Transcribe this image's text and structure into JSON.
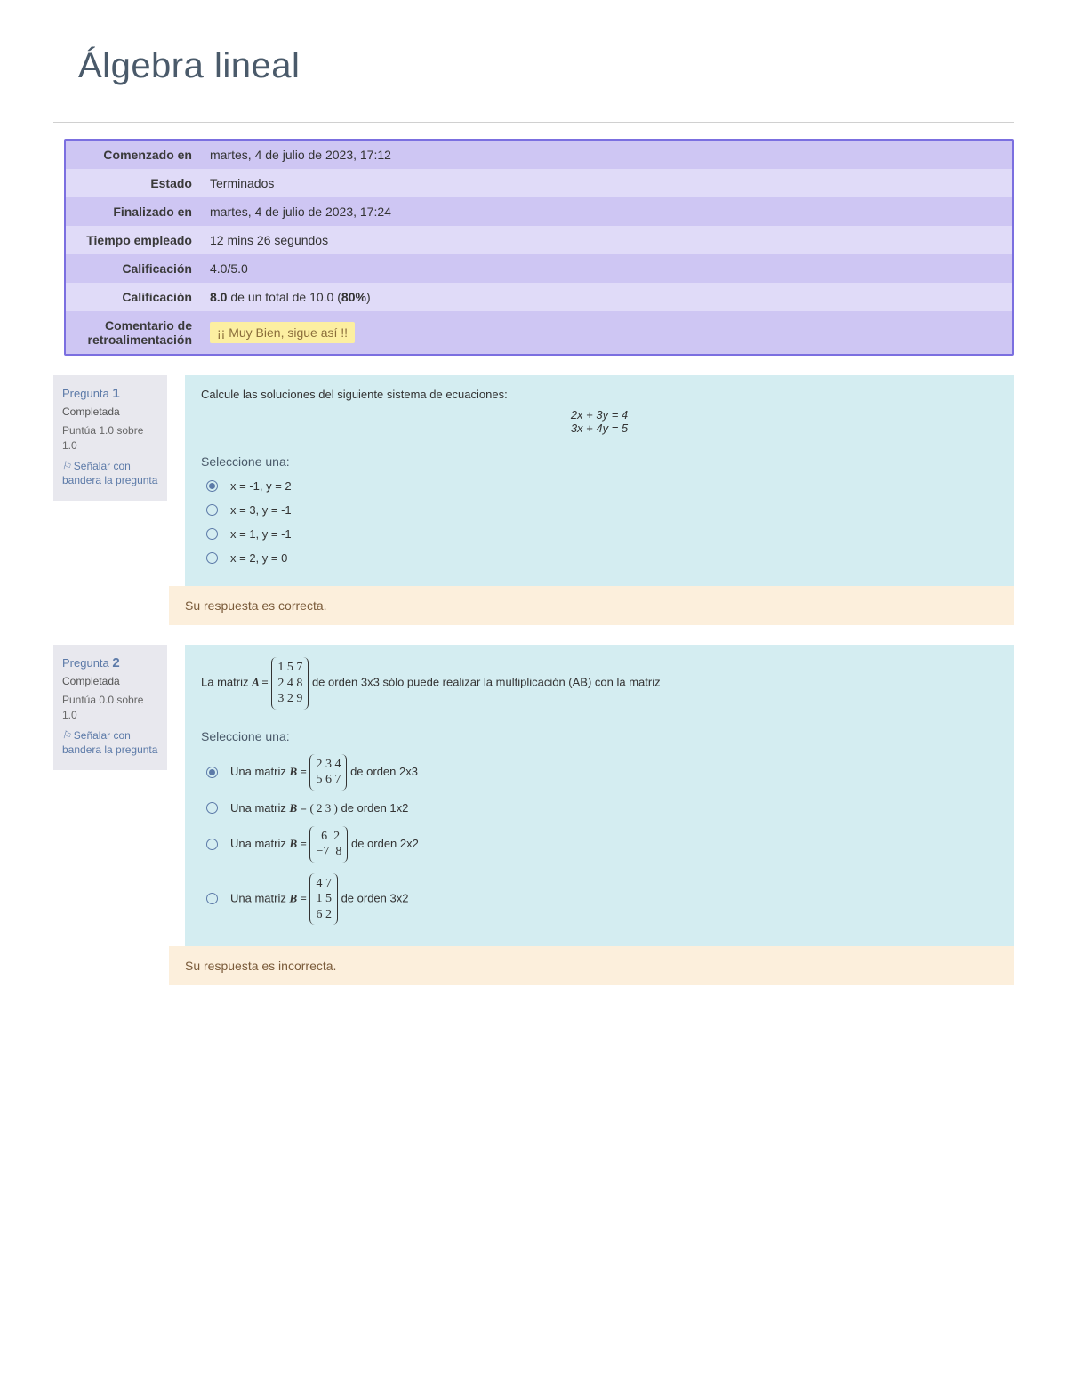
{
  "page_title": "Álgebra lineal",
  "summary_labels": {
    "started": "Comenzado en",
    "state": "Estado",
    "completed": "Finalizado en",
    "time": "Tiempo empleado",
    "grade1": "Calificación",
    "grade2": "Calificación",
    "feedback": "Comentario de retroalimentación"
  },
  "summary_values": {
    "started": "martes, 4 de julio de 2023, 17:12",
    "state": "Terminados",
    "completed": "martes, 4 de julio de 2023, 17:24",
    "time": "12 mins 26 segundos",
    "grade1": "4.0/5.0",
    "grade2_bold": "8.0",
    "grade2_mid": " de un total de 10.0 (",
    "grade2_pct": "80%",
    "grade2_end": ")",
    "feedback": "¡¡ Muy Bien, sigue así !!"
  },
  "flag_text": "Señalar con bandera la pregunta",
  "q1": {
    "label_prefix": "Pregunta ",
    "number": "1",
    "state": "Completada",
    "grade": "Puntúa 1.0 sobre 1.0",
    "text": "Calcule las soluciones del siguiente sistema de ecuaciones:",
    "eq1": "2x + 3y = 4",
    "eq2": "3x + 4y = 5",
    "select": "Seleccione una:",
    "options": [
      "x = -1, y = 2",
      "x = 3, y = -1",
      "x = 1, y = -1",
      "x = 2, y = 0"
    ],
    "selected": 0,
    "feedback": "Su respuesta es correcta."
  },
  "q2": {
    "label_prefix": "Pregunta ",
    "number": "2",
    "state": "Completada",
    "grade": "Puntúa 0.0 sobre 1.0",
    "text_pre": "La matriz ",
    "text_mid": " de orden 3x3 sólo puede realizar la multiplicación (AB) con la matriz",
    "matrix_A": [
      "1 5 7",
      "2 4 8",
      "3 2 9"
    ],
    "select": "Seleccione una:",
    "options": [
      {
        "pre": "Una matriz ",
        "rows": [
          "2 3 4",
          "5 6 7"
        ],
        "post": " de orden 2x3"
      },
      {
        "pre": "Una matriz ",
        "inline_text": "( 2  3 )",
        "post": " de orden 1x2"
      },
      {
        "pre": "Una matriz ",
        "rows": [
          " 6  2",
          "−7  8"
        ],
        "post": " de orden 2x2"
      },
      {
        "pre": "Una matriz ",
        "rows": [
          "4 7",
          "1 5",
          "6 2"
        ],
        "post": " de orden 3x2"
      }
    ],
    "selected": 0,
    "feedback": "Su respuesta es incorrecta."
  }
}
